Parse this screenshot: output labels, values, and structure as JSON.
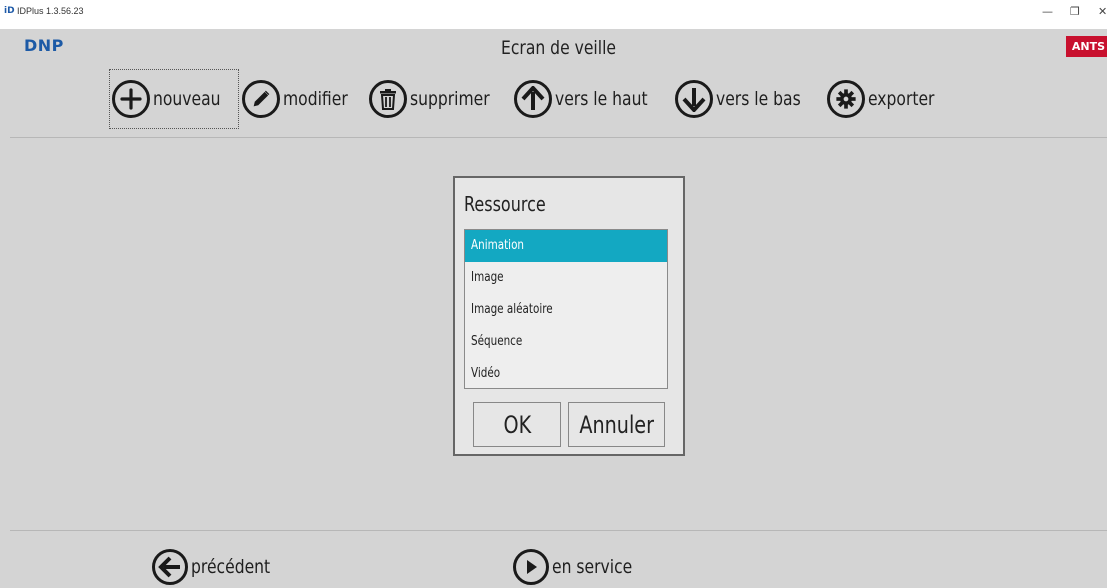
{
  "window": {
    "title": "IDPlus 1.3.56.23",
    "icon_text": "iD",
    "minimize_glyph": "—",
    "restore_glyph": "❐",
    "close_glyph": "✕"
  },
  "header": {
    "brand": "DNP",
    "screen_title": "Ecran de veille",
    "badge": "ANTS"
  },
  "toolbar": {
    "new_label": "nouveau",
    "edit_label": "modifier",
    "delete_label": "supprimer",
    "up_label": "vers le haut",
    "down_label": "vers le bas",
    "export_label": "exporter"
  },
  "dialog": {
    "title": "Ressource",
    "items": [
      {
        "label": "Animation"
      },
      {
        "label": "Image"
      },
      {
        "label": "Image aléatoire"
      },
      {
        "label": "Séquence"
      },
      {
        "label": "Vidéo"
      }
    ],
    "ok_label": "OK",
    "cancel_label": "Annuler"
  },
  "footer": {
    "previous_label": "précédent",
    "in_service_label": "en service"
  },
  "colors": {
    "selection": "#13a8c2",
    "brand": "#1c5aa6",
    "badge": "#c8102e"
  }
}
